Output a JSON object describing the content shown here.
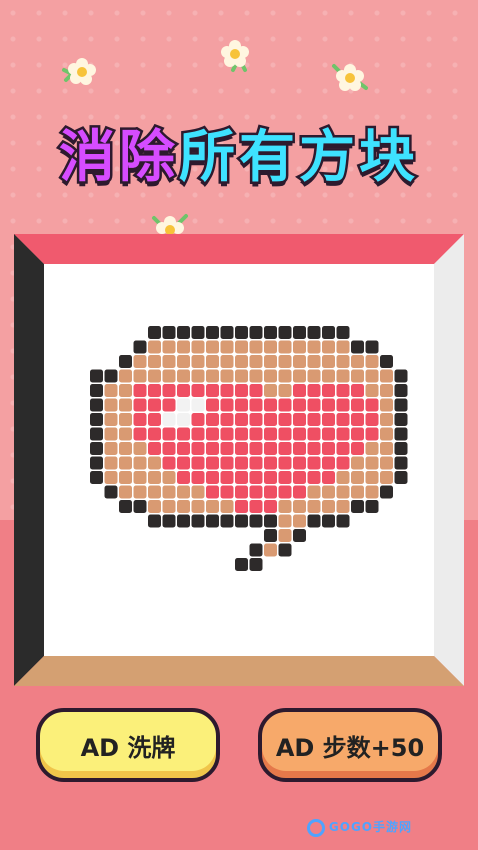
{
  "title": {
    "part1": "消除",
    "part2": "所有方块"
  },
  "buttons": {
    "shuffle": "AD 洗牌",
    "steps": "AD 步数+50"
  },
  "watermark": "GOGO手游网",
  "colors": {
    "outline": "#2d2a2a",
    "tan": "#d99a72",
    "heart": "#ef4f63",
    "highlight": "#f2f2f2"
  },
  "puzzle": {
    "rows": [
      "....SSSSSSSSSSSSSS....",
      "...SBBBBBBBBBBBBBBSS..",
      "..SBBBBBBBBBBBBBBBBBS.",
      "SSBBBBBBBBBBBBBBBBBBBS",
      "SBBHHHHHHHHHBBHHHHHBBS",
      "SBBHHHWWHHHHHHHHHHHHBS",
      "SBBHHWWHHHHHHHHHHHHHBS",
      "SBBHHHHHHHHHHHHHHHHHBS",
      "SBBBHHHHHHHHHHHHHHHBBS",
      "SBBBBHHHHHHHHHHHHHBBBS",
      "SBBBBBHHHHHHHHHHHBBBBS",
      ".SBBBBBBHHHHHHHBBBBBS.",
      "..SSBBBBBBHHHBBBBBSS..",
      "....SSSSSSSSSBBSSS....",
      "............SBS.......",
      "...........SBS........",
      "..........SS.........."
    ]
  }
}
